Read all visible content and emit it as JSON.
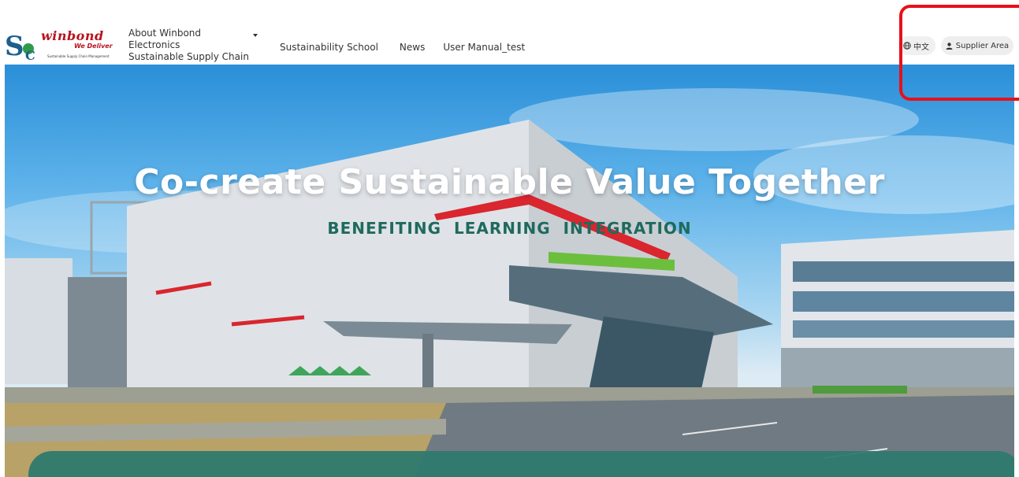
{
  "header": {
    "logo": {
      "brand": "winbond",
      "tagline": "We Deliver",
      "subtitle": "Sustainable Supply Chain Management"
    },
    "nav": [
      {
        "label_line1": "About Winbond Electronics",
        "label_line2": "Sustainable Supply Chain",
        "has_dropdown": true
      },
      {
        "label": "Sustainability School"
      },
      {
        "label": "News"
      },
      {
        "label": "User Manual_test"
      }
    ],
    "language_label": "中文",
    "supplier_label": "Supplier Area"
  },
  "hero": {
    "title": "Co-create Sustainable Value Together",
    "subtitle": "BENEFITING LEARNING INTEGRATION"
  },
  "colors": {
    "brand_red": "#b8131e",
    "teal": "#1f6a5e",
    "highlight": "#e8101a"
  },
  "icons": {
    "language": "globe-icon",
    "supplier": "user-icon",
    "dropdown": "caret-down-icon"
  }
}
